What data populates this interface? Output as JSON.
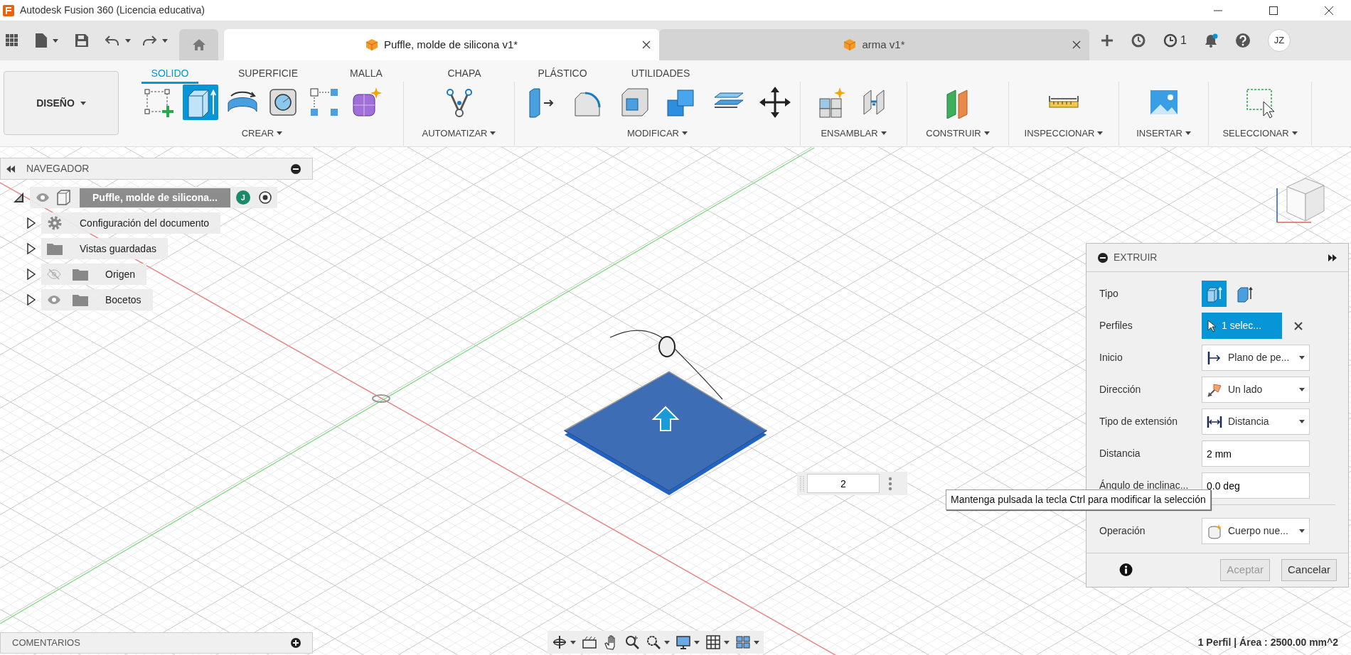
{
  "window": {
    "title": "Autodesk Fusion 360 (Licencia educativa)"
  },
  "doc_tabs": [
    {
      "label": "Puffle, molde de silicona v1*",
      "selected": true
    },
    {
      "label": "arma v1*",
      "selected": false
    }
  ],
  "header_right": {
    "job_count": "1",
    "user_initials": "JZ"
  },
  "workspace": {
    "label": "DISEÑO"
  },
  "ribbon_tabs": [
    {
      "label": "SOLIDO",
      "selected": true
    },
    {
      "label": "SUPERFICIE",
      "selected": false
    },
    {
      "label": "MALLA",
      "selected": false
    },
    {
      "label": "CHAPA",
      "selected": false
    },
    {
      "label": "PLÁSTICO",
      "selected": false
    },
    {
      "label": "UTILIDADES",
      "selected": false
    }
  ],
  "ribbon_groups": [
    {
      "label": "CREAR",
      "tools": [
        {
          "selected": false
        },
        {
          "selected": true
        },
        {
          "selected": false
        },
        {
          "selected": false
        },
        {
          "selected": false
        },
        {
          "selected": false
        }
      ]
    },
    {
      "label": "AUTOMATIZAR",
      "tools": [
        {
          "selected": false
        }
      ]
    },
    {
      "label": "MODIFICAR",
      "tools": [
        {
          "selected": false
        },
        {
          "selected": false
        },
        {
          "selected": false
        },
        {
          "selected": false
        },
        {
          "selected": false
        },
        {
          "selected": false
        }
      ]
    },
    {
      "label": "ENSAMBLAR",
      "tools": [
        {
          "selected": false
        },
        {
          "selected": false
        }
      ]
    },
    {
      "label": "CONSTRUIR",
      "tools": [
        {
          "selected": false
        }
      ]
    },
    {
      "label": "INSPECCIONAR",
      "tools": [
        {
          "selected": false
        }
      ]
    },
    {
      "label": "INSERTAR",
      "tools": [
        {
          "selected": false
        }
      ]
    },
    {
      "label": "SELECCIONAR",
      "tools": [
        {
          "selected": false
        }
      ]
    }
  ],
  "navigator": {
    "title": "NAVEGADOR",
    "root": {
      "label": "Puffle, molde de silicona...",
      "owner_initial": "J",
      "expanded": true,
      "visible": true,
      "children": [
        {
          "label": "Configuración del documento",
          "kind": "settings",
          "expanded": false
        },
        {
          "label": "Vistas guardadas",
          "kind": "folder",
          "expanded": false
        },
        {
          "label": "Origen",
          "kind": "folder",
          "expanded": false,
          "visible": false
        },
        {
          "label": "Bocetos",
          "kind": "folder",
          "expanded": false,
          "visible": true
        }
      ]
    }
  },
  "extrude_panel": {
    "title": "EXTRUIR",
    "rows": [
      {
        "label": "Tipo",
        "kind": "toggle",
        "options": [
          {
            "selected": true
          },
          {
            "selected": false
          }
        ]
      },
      {
        "label": "Perfiles",
        "kind": "selection",
        "value": "1 selec..."
      },
      {
        "label": "Inicio",
        "kind": "dropdown",
        "value": "Plano de pe..."
      },
      {
        "label": "Dirección",
        "kind": "dropdown",
        "value": "Un lado"
      },
      {
        "label": "Tipo de extensión",
        "kind": "dropdown",
        "value": "Distancia"
      },
      {
        "label": "Distancia",
        "kind": "input",
        "value": "2 mm"
      },
      {
        "label": "Ángulo de inclinac...",
        "kind": "input",
        "value": "0.0 deg"
      },
      {
        "label": "Operación",
        "kind": "dropdown",
        "value": "Cuerpo nue..."
      }
    ],
    "buttons": [
      {
        "label": "Aceptar",
        "disabled": true
      },
      {
        "label": "Cancelar",
        "disabled": false
      }
    ]
  },
  "tooltip": {
    "text": "Mantenga pulsada la tecla Ctrl para modificar la selección"
  },
  "distance_input": {
    "value": "2"
  },
  "comments": {
    "title": "COMENTARIOS"
  },
  "status_bar": {
    "text": "1 Perfil | Área : 2500.00 mm^2"
  }
}
